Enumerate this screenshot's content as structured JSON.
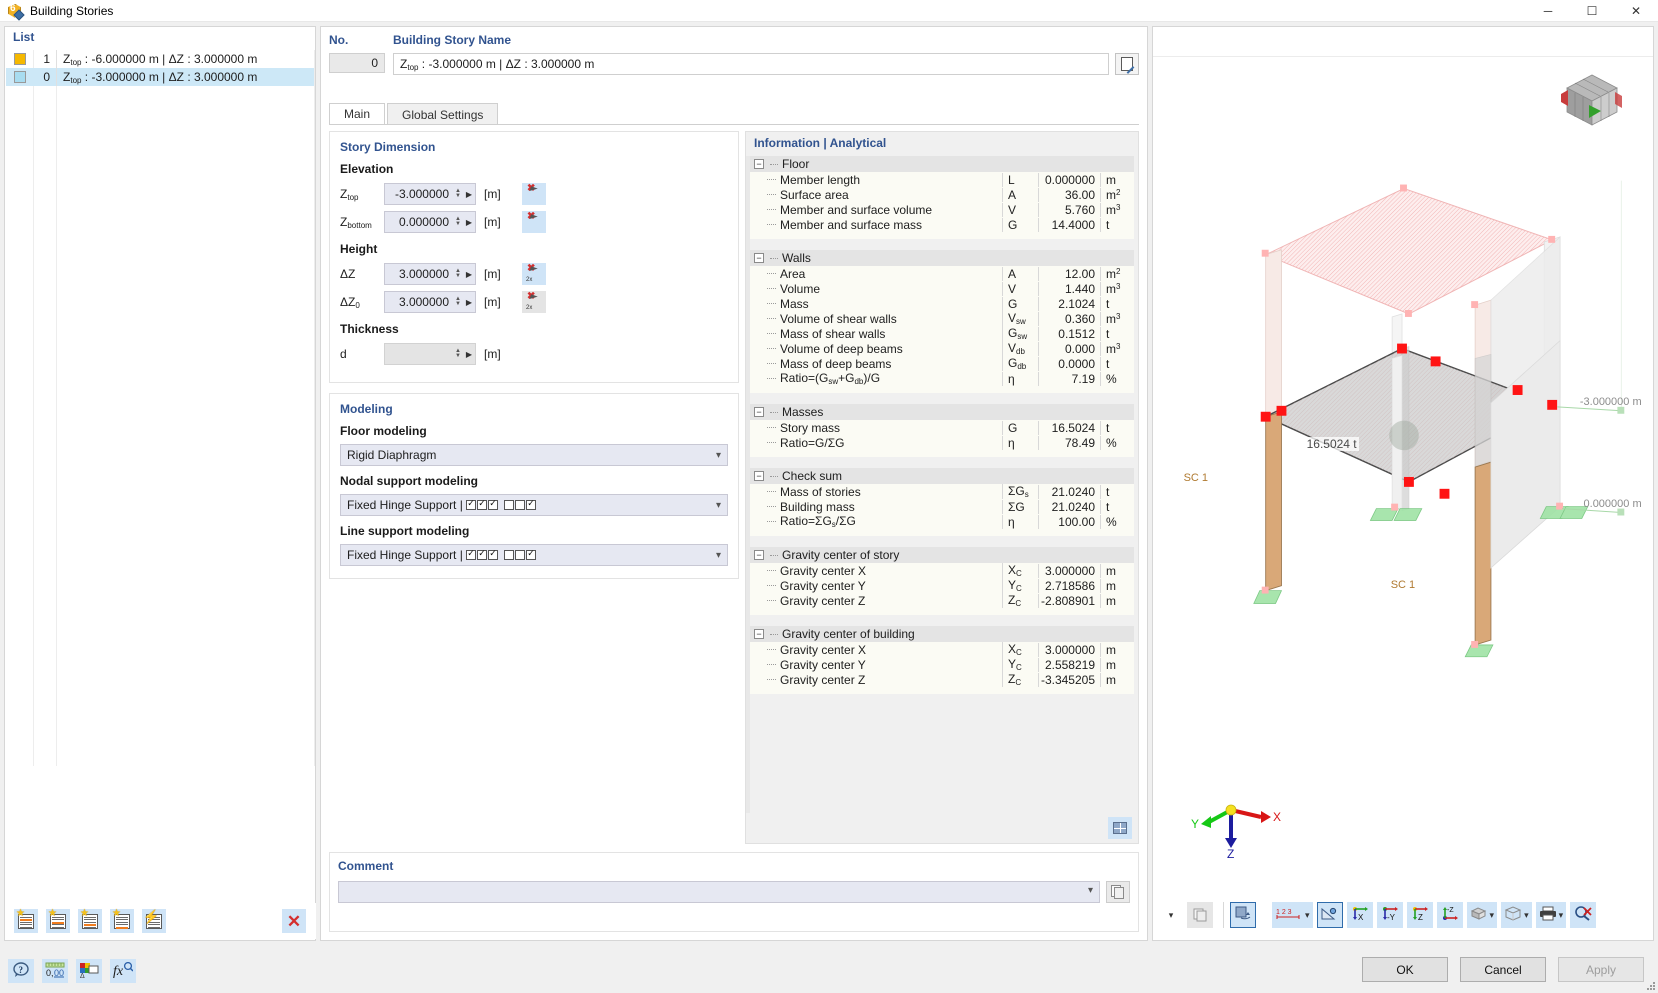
{
  "window": {
    "title": "Building Stories",
    "minimize": "─",
    "maximize": "☐",
    "close": "✕",
    "icon": "building-stories-icon"
  },
  "list_panel": {
    "header": "List",
    "rows": [
      {
        "color": "#f5b800",
        "index": "1",
        "ztop_label": "Z",
        "ztop_sub": "top",
        "text": " : -6.000000 m | ΔZ : 3.000000 m",
        "selected": false
      },
      {
        "color": "#a8dcf0",
        "index": "0",
        "ztop_label": "Z",
        "ztop_sub": "top",
        "text": " : -3.000000 m | ΔZ : 3.000000 m",
        "selected": true
      }
    ],
    "toolbar": [
      {
        "name": "new-story-above-button",
        "icon": "sheet-star-top"
      },
      {
        "name": "new-story-middle-button",
        "icon": "sheet-star-mid"
      },
      {
        "name": "new-story-below-button",
        "icon": "sheet-star-low"
      },
      {
        "name": "new-story-bottom-button",
        "icon": "sheet-star-bottom"
      },
      {
        "name": "generate-stories-button",
        "icon": "sheet-bolt"
      }
    ],
    "delete_label": "✕"
  },
  "header": {
    "no_label": "No.",
    "no_value": "0",
    "name_label": "Building Story Name",
    "name_prefix": "Z",
    "name_sub": "top",
    "name_value": " : -3.000000 m | ΔZ : 3.000000 m",
    "edit_button": "edit-name-button"
  },
  "tabs": [
    {
      "label": "Main",
      "active": true
    },
    {
      "label": "Global Settings",
      "active": false
    }
  ],
  "story_dimension": {
    "title": "Story Dimension",
    "elevation_head": "Elevation",
    "height_head": "Height",
    "thickness_head": "Thickness",
    "fields": [
      {
        "sym": "Z",
        "sub": "top",
        "value": "-3.000000",
        "unit": "[m]",
        "pick": "pick-ztop-button",
        "disabled": false,
        "pickdisabled": false
      },
      {
        "sym": "Z",
        "sub": "bottom",
        "value": "0.000000",
        "unit": "[m]",
        "pick": "pick-zbottom-button",
        "disabled": false,
        "pickdisabled": false
      },
      {
        "sym": "ΔZ",
        "sub": "",
        "value": "3.000000",
        "unit": "[m]",
        "pick": "pick-dz-button",
        "disabled": false,
        "pickdisabled": false
      },
      {
        "sym": "ΔZ",
        "sub": "0",
        "value": "3.000000",
        "unit": "[m]",
        "pick": "pick-dz0-button",
        "disabled": false,
        "pickdisabled": true
      },
      {
        "sym": "d",
        "sub": "",
        "value": "",
        "unit": "[m]",
        "pick": "",
        "disabled": true,
        "pickdisabled": true
      }
    ]
  },
  "modeling": {
    "title": "Modeling",
    "floor_label": "Floor modeling",
    "floor_value": "Rigid Diaphragm",
    "nodal_label": "Nodal support modeling",
    "nodal_value": "Fixed Hinge Support | ",
    "nodal_checks": [
      true,
      true,
      true,
      false,
      false,
      true
    ],
    "line_label": "Line support modeling",
    "line_value": "Fixed Hinge Support | ",
    "line_checks": [
      true,
      true,
      true,
      false,
      false,
      true
    ]
  },
  "information": {
    "title": "Information | Analytical",
    "groups": [
      {
        "name": "Floor",
        "rows": [
          {
            "name": "Member length",
            "sym": "L",
            "sub": "",
            "value": "0.000000",
            "unit": "m",
            "unit_sup": ""
          },
          {
            "name": "Surface area",
            "sym": "A",
            "sub": "",
            "value": "36.00",
            "unit": "m",
            "unit_sup": "2"
          },
          {
            "name": "Member and surface volume",
            "sym": "V",
            "sub": "",
            "value": "5.760",
            "unit": "m",
            "unit_sup": "3"
          },
          {
            "name": "Member and surface mass",
            "sym": "G",
            "sub": "",
            "value": "14.4000",
            "unit": "t",
            "unit_sup": ""
          }
        ]
      },
      {
        "name": "Walls",
        "rows": [
          {
            "name": "Area",
            "sym": "A",
            "sub": "",
            "value": "12.00",
            "unit": "m",
            "unit_sup": "2"
          },
          {
            "name": "Volume",
            "sym": "V",
            "sub": "",
            "value": "1.440",
            "unit": "m",
            "unit_sup": "3"
          },
          {
            "name": "Mass",
            "sym": "G",
            "sub": "",
            "value": "2.1024",
            "unit": "t",
            "unit_sup": ""
          },
          {
            "name": "Volume of shear walls",
            "sym": "V",
            "sub": "sw",
            "value": "0.360",
            "unit": "m",
            "unit_sup": "3"
          },
          {
            "name": "Mass of shear walls",
            "sym": "G",
            "sub": "sw",
            "value": "0.1512",
            "unit": "t",
            "unit_sup": ""
          },
          {
            "name": "Volume of deep beams",
            "sym": "V",
            "sub": "db",
            "value": "0.000",
            "unit": "m",
            "unit_sup": "3"
          },
          {
            "name": "Mass of deep beams",
            "sym": "G",
            "sub": "db",
            "value": "0.0000",
            "unit": "t",
            "unit_sup": ""
          },
          {
            "name": "Ratio=(Gsw+Gdb)/G",
            "sym": "η",
            "sub": "",
            "value": "7.19",
            "unit": "%",
            "unit_sup": ""
          }
        ]
      },
      {
        "name": "Masses",
        "rows": [
          {
            "name": "Story mass",
            "sym": "G",
            "sub": "",
            "value": "16.5024",
            "unit": "t",
            "unit_sup": ""
          },
          {
            "name": "Ratio=G/ΣG",
            "sym": "η",
            "sub": "",
            "value": "78.49",
            "unit": "%",
            "unit_sup": ""
          }
        ]
      },
      {
        "name": "Check sum",
        "rows": [
          {
            "name": "Mass of stories",
            "sym": "ΣG",
            "sub": "s",
            "value": "21.0240",
            "unit": "t",
            "unit_sup": ""
          },
          {
            "name": "Building mass",
            "sym": "ΣG",
            "sub": "",
            "value": "21.0240",
            "unit": "t",
            "unit_sup": ""
          },
          {
            "name": "Ratio=ΣGs/ΣG",
            "sym": "η",
            "sub": "",
            "value": "100.00",
            "unit": "%",
            "unit_sup": ""
          }
        ]
      },
      {
        "name": "Gravity center of story",
        "rows": [
          {
            "name": "Gravity center X",
            "sym": "X",
            "sub": "C",
            "value": "3.000000",
            "unit": "m",
            "unit_sup": ""
          },
          {
            "name": "Gravity center Y",
            "sym": "Y",
            "sub": "C",
            "value": "2.718586",
            "unit": "m",
            "unit_sup": ""
          },
          {
            "name": "Gravity center Z",
            "sym": "Z",
            "sub": "C",
            "value": "-2.808901",
            "unit": "m",
            "unit_sup": ""
          }
        ]
      },
      {
        "name": "Gravity center of building",
        "rows": [
          {
            "name": "Gravity center X",
            "sym": "X",
            "sub": "C",
            "value": "3.000000",
            "unit": "m",
            "unit_sup": ""
          },
          {
            "name": "Gravity center Y",
            "sym": "Y",
            "sub": "C",
            "value": "2.558219",
            "unit": "m",
            "unit_sup": ""
          },
          {
            "name": "Gravity center Z",
            "sym": "Z",
            "sub": "C",
            "value": "-3.345205",
            "unit": "m",
            "unit_sup": ""
          }
        ]
      }
    ],
    "table_button": "info-table-button"
  },
  "comment": {
    "label": "Comment",
    "value": "",
    "copy_button": "comment-copy-button"
  },
  "viewport": {
    "mass_label": "16.5024 t",
    "support_label_1": "SC 1",
    "support_label_2": "SC 1",
    "elevation_top": "-3.000000 m",
    "elevation_bottom": "0.000000 m",
    "axis_x": "X",
    "axis_y": "Y",
    "axis_z": "Z",
    "toolbar": [
      {
        "name": "render-toggle-button",
        "icon": "render-icon",
        "selected": true,
        "caret": false
      },
      {
        "name": "numbering-button",
        "icon": "numbering-123-icon",
        "selected": false,
        "caret": true
      },
      {
        "name": "measure-button",
        "icon": "measure-icon",
        "selected": true,
        "caret": false
      },
      {
        "name": "view-in-x-button",
        "icon": "axis-x-icon",
        "selected": false,
        "caret": false
      },
      {
        "name": "view-in-y-button",
        "icon": "axis-y-icon",
        "selected": false,
        "caret": false
      },
      {
        "name": "view-in-z-button",
        "icon": "axis-z-icon",
        "selected": false,
        "caret": false
      },
      {
        "name": "view-in-negative-z-button",
        "icon": "axis-neg-z-icon",
        "selected": false,
        "caret": false
      },
      {
        "name": "render-mode-button",
        "icon": "solid-box-icon",
        "selected": false,
        "caret": true
      },
      {
        "name": "wireframe-button",
        "icon": "wire-box-icon",
        "selected": false,
        "caret": true
      },
      {
        "name": "print-button",
        "icon": "printer-icon",
        "selected": false,
        "caret": true
      },
      {
        "name": "reset-zoom-button",
        "icon": "zoom-reset-icon",
        "selected": false,
        "caret": false
      }
    ]
  },
  "bottom": {
    "left_buttons": [
      {
        "name": "help-button",
        "icon": "question-icon"
      },
      {
        "name": "units-button",
        "icon": "units-000-icon"
      },
      {
        "name": "display-properties-button",
        "icon": "display-props-icon"
      },
      {
        "name": "formula-button",
        "icon": "fx-icon"
      }
    ],
    "ok": "OK",
    "cancel": "Cancel",
    "apply": "Apply"
  },
  "colors": {
    "accent": "#31538f",
    "selection": "#cde8f7",
    "icon_bg": "#cfe4f7",
    "field_bg": "#e6e8f2",
    "danger": "#d42f2f"
  }
}
